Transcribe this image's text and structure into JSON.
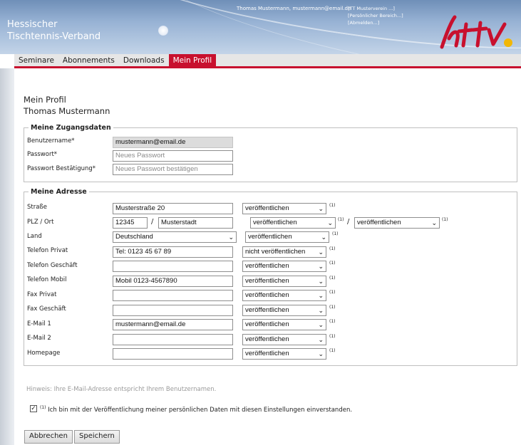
{
  "header": {
    "org_line1": "Hessischer",
    "org_line2": "Tischtennis-Verband",
    "user_info": "Thomas Mustermann, mustermann@email.de",
    "links": [
      "[TT Musterverein ...]",
      "[Persönlicher Bereich...]",
      "[Abmelden...]"
    ],
    "logo_text": "httv",
    "colors": {
      "header_blue": "#7f9dc3",
      "accent_red": "#c8102e",
      "logo_yellow": "#f2b705"
    }
  },
  "nav": {
    "items": [
      "Seminare",
      "Abonnements",
      "Downloads",
      "Mein Profil"
    ],
    "active": "Mein Profil"
  },
  "page": {
    "title": "Mein Profil",
    "subtitle": "Thomas Mustermann"
  },
  "login": {
    "legend": "Meine Zugangsdaten",
    "username_label": "Benutzername*",
    "username_value": "mustermann@email.de",
    "password_label": "Passwort*",
    "password_placeholder": "Neues Passwort",
    "confirm_label": "Passwort Bestätigung*",
    "confirm_placeholder": "Neues Passwort bestätigen"
  },
  "address": {
    "legend": "Meine Adresse",
    "note_mark": "(1)",
    "rows": [
      {
        "label": "Straße",
        "value": "Musterstraße 20",
        "visibility": "veröffentlichen"
      },
      {
        "label": "PLZ / Ort",
        "zip": "12345",
        "city": "Musterstadt",
        "visibility": "veröffentlichen",
        "visibility2": "veröffentlichen"
      },
      {
        "label": "Land",
        "value": "Deutschland",
        "visibility": "veröffentlichen"
      },
      {
        "label": "Telefon Privat",
        "value": "Tel: 0123 45 67 89",
        "visibility": "nicht veröffentlichen"
      },
      {
        "label": "Telefon Geschäft",
        "value": "",
        "visibility": "veröffentlichen"
      },
      {
        "label": "Telefon Mobil",
        "value": "Mobil 0123-4567890",
        "visibility": "veröffentlichen"
      },
      {
        "label": "Fax Privat",
        "value": "",
        "visibility": "veröffentlichen"
      },
      {
        "label": "Fax Geschäft",
        "value": "",
        "visibility": "veröffentlichen"
      },
      {
        "label": "E-Mail 1",
        "value": "mustermann@email.de",
        "visibility": "veröffentlichen"
      },
      {
        "label": "E-Mail 2",
        "value": "",
        "visibility": "veröffentlichen"
      },
      {
        "label": "Homepage",
        "value": "",
        "visibility": "veröffentlichen"
      }
    ]
  },
  "hint": "Hinweis: Ihre E-Mail-Adresse entspricht Ihrem Benutzernamen.",
  "consent": {
    "checked": true,
    "mark": "(1)",
    "text": "Ich bin mit der Veröffentlichung meiner persönlichen Daten mit diesen Einstellungen einverstanden."
  },
  "buttons": {
    "cancel": "Abbrechen",
    "save": "Speichern"
  }
}
